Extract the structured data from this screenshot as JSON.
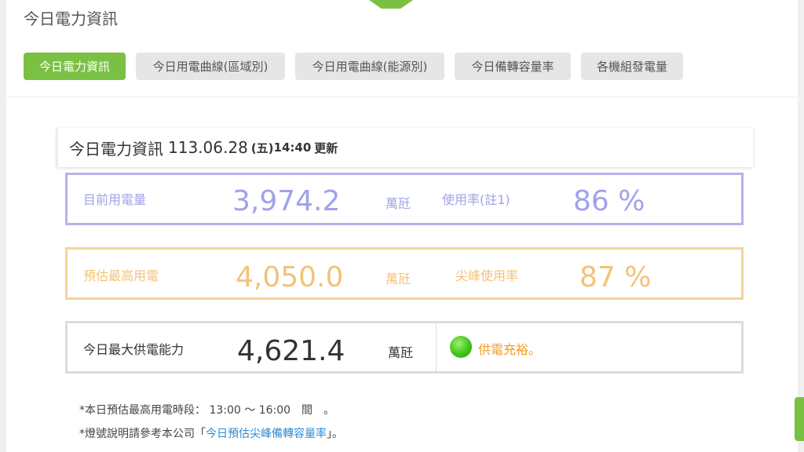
{
  "page_title": "今日電力資訊",
  "tabs": [
    {
      "label": "今日電力資訊",
      "active": true
    },
    {
      "label": "今日用電曲線(區域別)",
      "active": false
    },
    {
      "label": "今日用電曲線(能源別)",
      "active": false
    },
    {
      "label": "今日備轉容量率",
      "active": false
    },
    {
      "label": "各機組發電量",
      "active": false
    }
  ],
  "card": {
    "title": "今日電力資訊",
    "date": "113.06.28",
    "weekday": "(五)",
    "time": "14:40",
    "update_label": "更新"
  },
  "current_usage": {
    "label": "目前用電量",
    "value": "3,974.2",
    "unit": "萬瓩",
    "rate_label": "使用率(註1)",
    "rate_value": "86 %"
  },
  "peak_forecast": {
    "label": "預估最高用電",
    "value": "4,050.0",
    "unit": "萬瓩",
    "rate_label": "尖峰使用率",
    "rate_value": "87 %"
  },
  "max_supply": {
    "label": "今日最大供電能力",
    "value": "4,621.4",
    "unit": "萬瓩",
    "status_text": "供電充裕。",
    "status_color": "#3fc41c"
  },
  "notes": {
    "peak_period": "*本日預估最高用電時段： 13:00 ～ 16:00　間　。",
    "light_prefix": "*燈號說明請參考本公司「",
    "light_link": "今日預估尖峰備轉容量率",
    "light_suffix": "」。"
  },
  "colors": {
    "accent_green": "#7ac143",
    "usage_blue": "#9fa2ea",
    "peak_orange": "#f3c27a",
    "status_orange": "#f39a1e",
    "link_blue": "#2d8bd4"
  }
}
